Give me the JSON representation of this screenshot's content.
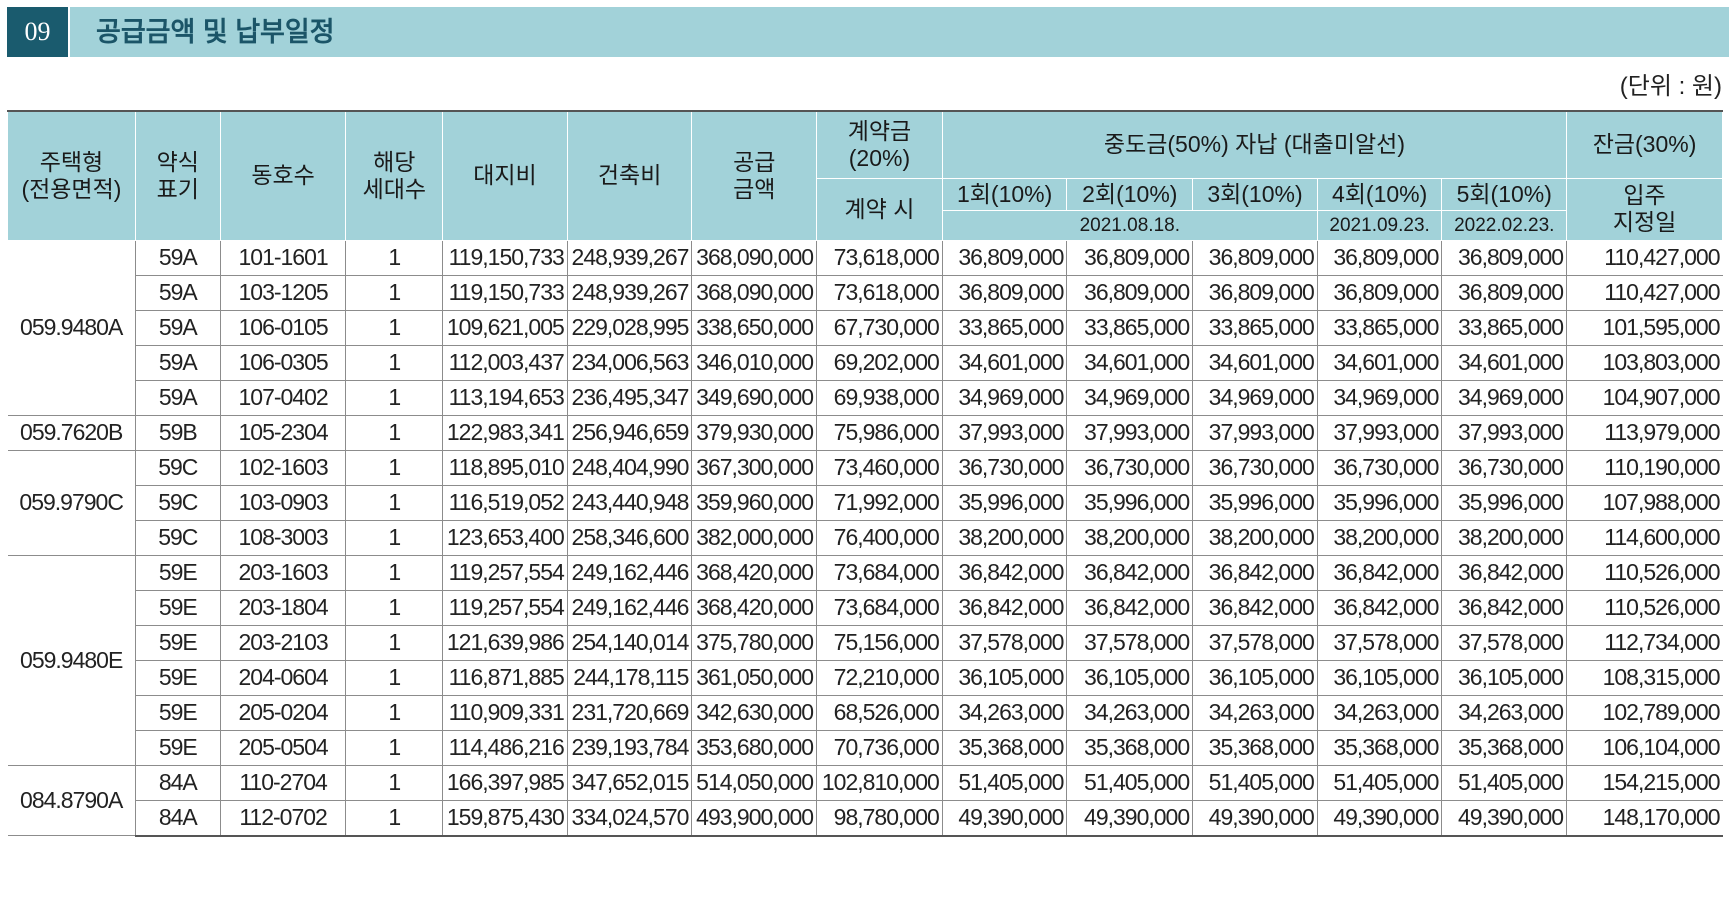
{
  "section": {
    "number": "09",
    "title": "공급금액 및 납부일정"
  },
  "unit": "(단위 : 원)",
  "headers": {
    "type": "주택형\n(전용면적)",
    "abbr": "약식\n표기",
    "unit_no": "동호수",
    "households": "해당\n세대수",
    "land": "대지비",
    "building": "건축비",
    "supply": "공급\n금액",
    "contract": "계약금\n(20%)",
    "contract_when": "계약 시",
    "middle": "중도금(50%) 자납 (대출미알선)",
    "m1": "1회(10%)",
    "m2": "2회(10%)",
    "m3": "3회(10%)",
    "m4": "4회(10%)",
    "m5": "5회(10%)",
    "date_123": "2021.08.18.",
    "date_4": "2021.09.23.",
    "date_5": "2022.02.23.",
    "balance": "잔금(30%)",
    "balance_when": "입주\n지정일"
  },
  "rows": [
    {
      "type": "059.9480A",
      "span": 5,
      "abbr": "59A",
      "unit": "101-1601",
      "hh": "1",
      "land": "119,150,733",
      "build": "248,939,267",
      "supply": "368,090,000",
      "contract": "73,618,000",
      "m1": "36,809,000",
      "m2": "36,809,000",
      "m3": "36,809,000",
      "m4": "36,809,000",
      "m5": "36,809,000",
      "bal": "110,427,000"
    },
    {
      "abbr": "59A",
      "unit": "103-1205",
      "hh": "1",
      "land": "119,150,733",
      "build": "248,939,267",
      "supply": "368,090,000",
      "contract": "73,618,000",
      "m1": "36,809,000",
      "m2": "36,809,000",
      "m3": "36,809,000",
      "m4": "36,809,000",
      "m5": "36,809,000",
      "bal": "110,427,000"
    },
    {
      "abbr": "59A",
      "unit": "106-0105",
      "hh": "1",
      "land": "109,621,005",
      "build": "229,028,995",
      "supply": "338,650,000",
      "contract": "67,730,000",
      "m1": "33,865,000",
      "m2": "33,865,000",
      "m3": "33,865,000",
      "m4": "33,865,000",
      "m5": "33,865,000",
      "bal": "101,595,000"
    },
    {
      "abbr": "59A",
      "unit": "106-0305",
      "hh": "1",
      "land": "112,003,437",
      "build": "234,006,563",
      "supply": "346,010,000",
      "contract": "69,202,000",
      "m1": "34,601,000",
      "m2": "34,601,000",
      "m3": "34,601,000",
      "m4": "34,601,000",
      "m5": "34,601,000",
      "bal": "103,803,000"
    },
    {
      "abbr": "59A",
      "unit": "107-0402",
      "hh": "1",
      "land": "113,194,653",
      "build": "236,495,347",
      "supply": "349,690,000",
      "contract": "69,938,000",
      "m1": "34,969,000",
      "m2": "34,969,000",
      "m3": "34,969,000",
      "m4": "34,969,000",
      "m5": "34,969,000",
      "bal": "104,907,000"
    },
    {
      "type": "059.7620B",
      "span": 1,
      "abbr": "59B",
      "unit": "105-2304",
      "hh": "1",
      "land": "122,983,341",
      "build": "256,946,659",
      "supply": "379,930,000",
      "contract": "75,986,000",
      "m1": "37,993,000",
      "m2": "37,993,000",
      "m3": "37,993,000",
      "m4": "37,993,000",
      "m5": "37,993,000",
      "bal": "113,979,000"
    },
    {
      "type": "059.9790C",
      "span": 3,
      "abbr": "59C",
      "unit": "102-1603",
      "hh": "1",
      "land": "118,895,010",
      "build": "248,404,990",
      "supply": "367,300,000",
      "contract": "73,460,000",
      "m1": "36,730,000",
      "m2": "36,730,000",
      "m3": "36,730,000",
      "m4": "36,730,000",
      "m5": "36,730,000",
      "bal": "110,190,000"
    },
    {
      "abbr": "59C",
      "unit": "103-0903",
      "hh": "1",
      "land": "116,519,052",
      "build": "243,440,948",
      "supply": "359,960,000",
      "contract": "71,992,000",
      "m1": "35,996,000",
      "m2": "35,996,000",
      "m3": "35,996,000",
      "m4": "35,996,000",
      "m5": "35,996,000",
      "bal": "107,988,000"
    },
    {
      "abbr": "59C",
      "unit": "108-3003",
      "hh": "1",
      "land": "123,653,400",
      "build": "258,346,600",
      "supply": "382,000,000",
      "contract": "76,400,000",
      "m1": "38,200,000",
      "m2": "38,200,000",
      "m3": "38,200,000",
      "m4": "38,200,000",
      "m5": "38,200,000",
      "bal": "114,600,000"
    },
    {
      "type": "059.9480E",
      "span": 6,
      "abbr": "59E",
      "unit": "203-1603",
      "hh": "1",
      "land": "119,257,554",
      "build": "249,162,446",
      "supply": "368,420,000",
      "contract": "73,684,000",
      "m1": "36,842,000",
      "m2": "36,842,000",
      "m3": "36,842,000",
      "m4": "36,842,000",
      "m5": "36,842,000",
      "bal": "110,526,000"
    },
    {
      "abbr": "59E",
      "unit": "203-1804",
      "hh": "1",
      "land": "119,257,554",
      "build": "249,162,446",
      "supply": "368,420,000",
      "contract": "73,684,000",
      "m1": "36,842,000",
      "m2": "36,842,000",
      "m3": "36,842,000",
      "m4": "36,842,000",
      "m5": "36,842,000",
      "bal": "110,526,000"
    },
    {
      "abbr": "59E",
      "unit": "203-2103",
      "hh": "1",
      "land": "121,639,986",
      "build": "254,140,014",
      "supply": "375,780,000",
      "contract": "75,156,000",
      "m1": "37,578,000",
      "m2": "37,578,000",
      "m3": "37,578,000",
      "m4": "37,578,000",
      "m5": "37,578,000",
      "bal": "112,734,000"
    },
    {
      "abbr": "59E",
      "unit": "204-0604",
      "hh": "1",
      "land": "116,871,885",
      "build": "244,178,115",
      "supply": "361,050,000",
      "contract": "72,210,000",
      "m1": "36,105,000",
      "m2": "36,105,000",
      "m3": "36,105,000",
      "m4": "36,105,000",
      "m5": "36,105,000",
      "bal": "108,315,000"
    },
    {
      "abbr": "59E",
      "unit": "205-0204",
      "hh": "1",
      "land": "110,909,331",
      "build": "231,720,669",
      "supply": "342,630,000",
      "contract": "68,526,000",
      "m1": "34,263,000",
      "m2": "34,263,000",
      "m3": "34,263,000",
      "m4": "34,263,000",
      "m5": "34,263,000",
      "bal": "102,789,000"
    },
    {
      "abbr": "59E",
      "unit": "205-0504",
      "hh": "1",
      "land": "114,486,216",
      "build": "239,193,784",
      "supply": "353,680,000",
      "contract": "70,736,000",
      "m1": "35,368,000",
      "m2": "35,368,000",
      "m3": "35,368,000",
      "m4": "35,368,000",
      "m5": "35,368,000",
      "bal": "106,104,000"
    },
    {
      "type": "084.8790A",
      "span": 2,
      "abbr": "84A",
      "unit": "110-2704",
      "hh": "1",
      "land": "166,397,985",
      "build": "347,652,015",
      "supply": "514,050,000",
      "contract": "102,810,000",
      "m1": "51,405,000",
      "m2": "51,405,000",
      "m3": "51,405,000",
      "m4": "51,405,000",
      "m5": "51,405,000",
      "bal": "154,215,000"
    },
    {
      "abbr": "84A",
      "unit": "112-0702",
      "hh": "1",
      "land": "159,875,430",
      "build": "334,024,570",
      "supply": "493,900,000",
      "contract": "98,780,000",
      "m1": "49,390,000",
      "m2": "49,390,000",
      "m3": "49,390,000",
      "m4": "49,390,000",
      "m5": "49,390,000",
      "bal": "148,170,000"
    }
  ]
}
